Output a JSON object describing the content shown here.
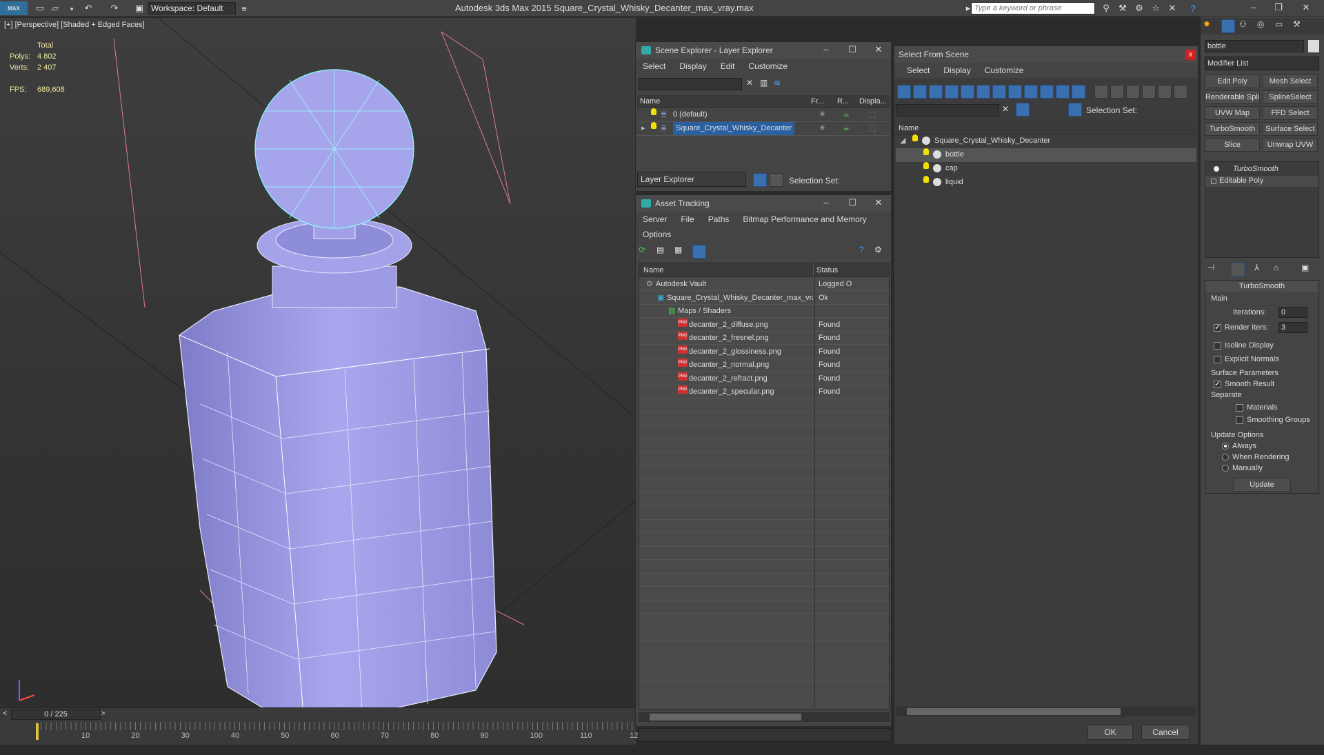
{
  "app": {
    "title": "Autodesk 3ds Max  2015     Square_Crystal_Whisky_Decanter_max_vray.max",
    "workspace": "Workspace: Default",
    "search_placeholder": "Type a keyword or phrase",
    "logo": "MAX"
  },
  "viewport": {
    "label": "[+] [Perspective] [Shaded + Edged Faces]",
    "stats": {
      "total_label": "Total",
      "polys_label": "Polys:",
      "polys": "4 802",
      "verts_label": "Verts:",
      "verts": "2 407",
      "fps_label": "FPS:",
      "fps": "689,608"
    }
  },
  "timeline": {
    "frame": "0 / 225",
    "ticks": [
      "10",
      "20",
      "30",
      "40",
      "50",
      "60",
      "70",
      "80",
      "90",
      "100",
      "110",
      "12"
    ],
    "prev": "<",
    "next": ">"
  },
  "scene_explorer": {
    "title": "Scene Explorer - Layer Explorer",
    "menu": [
      "Select",
      "Display",
      "Edit",
      "Customize"
    ],
    "columns": [
      "Name",
      "Fr...",
      "R...",
      "Displa..."
    ],
    "rows": [
      {
        "name": "0 (default)",
        "selected": false
      },
      {
        "name": "Square_Crystal_Whisky_Decanter",
        "selected": true
      }
    ],
    "footer_dropdown": "Layer Explorer",
    "selection_set_label": "Selection Set:"
  },
  "asset_tracking": {
    "title": "Asset Tracking",
    "menu": [
      "Server",
      "File",
      "Paths",
      "Bitmap Performance and Memory"
    ],
    "menu2": "Options",
    "columns": [
      "Name",
      "Status"
    ],
    "rows": [
      {
        "name": "Autodesk Vault",
        "status": "Logged O",
        "indent": 0
      },
      {
        "name": "Square_Crystal_Whisky_Decanter_max_vray.m...",
        "status": "Ok",
        "indent": 1
      },
      {
        "name": "Maps / Shaders",
        "status": "",
        "indent": 2
      },
      {
        "name": "decanter_2_diffuse.png",
        "status": "Found",
        "indent": 3
      },
      {
        "name": "decanter_2_fresnel.png",
        "status": "Found",
        "indent": 3
      },
      {
        "name": "decanter_2_glossiness.png",
        "status": "Found",
        "indent": 3
      },
      {
        "name": "decanter_2_normal.png",
        "status": "Found",
        "indent": 3
      },
      {
        "name": "decanter_2_refract.png",
        "status": "Found",
        "indent": 3
      },
      {
        "name": "decanter_2_specular.png",
        "status": "Found",
        "indent": 3
      }
    ]
  },
  "select_from_scene": {
    "title": "Select From Scene",
    "close": "x",
    "menu": [
      "Select",
      "Display",
      "Customize"
    ],
    "selection_set_label": "Selection Set:",
    "column": "Name",
    "tree": [
      {
        "name": "Square_Crystal_Whisky_Decanter",
        "indent": 0
      },
      {
        "name": "bottle",
        "indent": 1,
        "selected": true
      },
      {
        "name": "cap",
        "indent": 1
      },
      {
        "name": "liquid",
        "indent": 1
      }
    ],
    "ok": "OK",
    "cancel": "Cancel"
  },
  "modify_panel": {
    "object_name": "bottle",
    "modifier_list": "Modifier List",
    "buttons": [
      "Edit Poly",
      "Mesh Select",
      "Renderable Spline",
      "SplineSelect",
      "UVW Map",
      "FFD Select",
      "TurboSmooth",
      "Surface Select",
      "Slice",
      "Unwrap UVW"
    ],
    "stack": [
      "TurboSmooth",
      "Editable Poly"
    ],
    "rollout_title": "TurboSmooth",
    "main_label": "Main",
    "iterations_label": "Iterations:",
    "iterations": "0",
    "render_iters_label": "Render Iters:",
    "render_iters": "3",
    "isoline": "Isoline Display",
    "explicit_normals": "Explicit Normals",
    "surface_params": "Surface Parameters",
    "smooth_result": "Smooth Result",
    "separate": "Separate",
    "materials": "Materials",
    "smoothing_groups": "Smoothing Groups",
    "update_options": "Update Options",
    "always": "Always",
    "when_rendering": "When Rendering",
    "manually": "Manually",
    "update": "Update"
  }
}
